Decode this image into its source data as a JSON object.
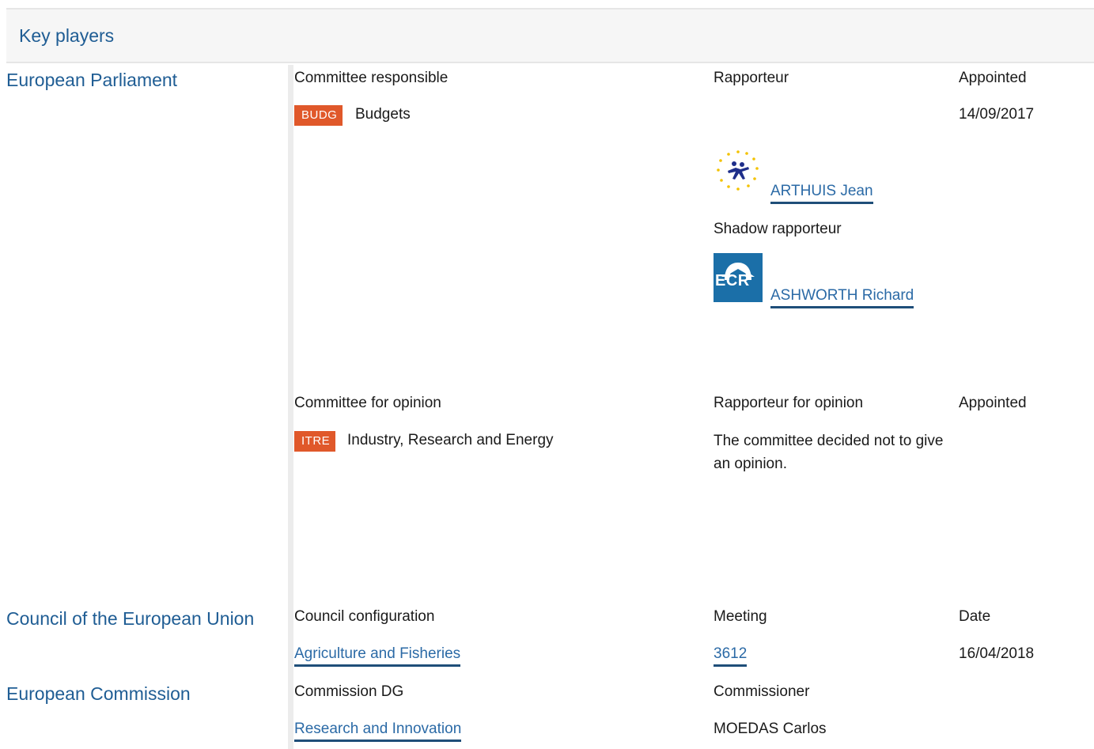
{
  "header": {
    "title": "Key players"
  },
  "ep": {
    "title": "European Parliament",
    "responsible": {
      "col_committee": "Committee responsible",
      "col_rapporteur": "Rapporteur",
      "col_appointed": "Appointed",
      "committee_code": "BUDG",
      "committee_name": "Budgets",
      "appointed_date": "14/09/2017",
      "rapporteur_name": "ARTHUIS Jean",
      "rapporteur_group_icon": "renew-europe-group-logo",
      "shadow_label": "Shadow rapporteur",
      "shadow_name": "ASHWORTH Richard",
      "shadow_group_icon": "ecr-group-logo",
      "shadow_group_text": "ECR"
    },
    "opinion": {
      "col_committee": "Committee for opinion",
      "col_rapporteur": "Rapporteur for opinion",
      "col_appointed": "Appointed",
      "committee_code": "ITRE",
      "committee_name": "Industry, Research and Energy",
      "note": "The committee decided not to give an opinion."
    }
  },
  "council": {
    "title": "Council of the European Union",
    "col_config": "Council configuration",
    "col_meeting": "Meeting",
    "col_date": "Date",
    "config_name": "Agriculture and Fisheries",
    "meeting_number": "3612",
    "date": "16/04/2018"
  },
  "commission": {
    "title": "European Commission",
    "col_dg": "Commission DG",
    "col_commissioner": "Commissioner",
    "dg_name": "Research and Innovation",
    "commissioner_name": "MOEDAS Carlos"
  },
  "colors": {
    "heading_blue": "#1f5d94",
    "link_blue": "#2b6aa6",
    "badge_orange": "#e0582a",
    "ecr_blue": "#1b6fa8"
  }
}
